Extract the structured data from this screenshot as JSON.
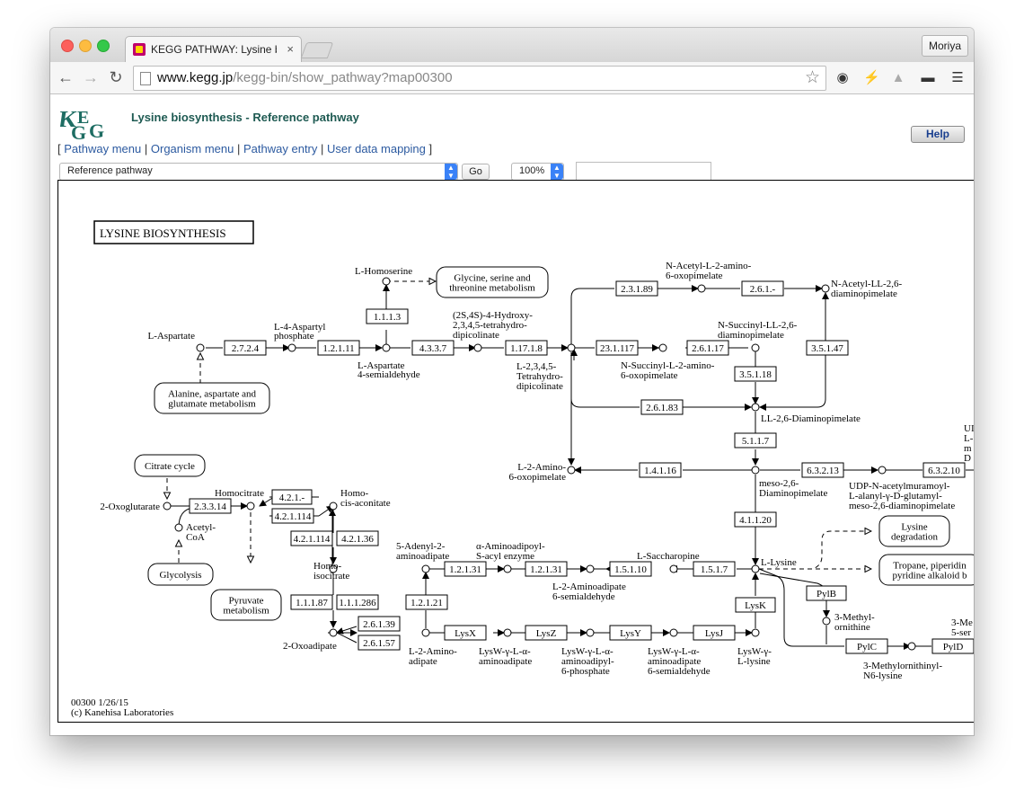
{
  "browser": {
    "tab_title": "KEGG PATHWAY: Lysine bio",
    "tab_close": "×",
    "profile": "Moriya",
    "url_host": "www.kegg.jp",
    "url_path": "/kegg-bin/show_pathway?map00300",
    "icons": [
      "back-arrow-icon",
      "forward-arrow-icon",
      "reload-icon",
      "page-icon",
      "bookmark-star-icon",
      "extension-icon",
      "lightning-icon",
      "drive-icon",
      "incognito-icon",
      "menu-icon"
    ]
  },
  "page": {
    "logo_alt": "KEGG",
    "title": "Lysine biosynthesis - Reference pathway",
    "help": "Help",
    "menu_open": "[",
    "menu_close": "]",
    "menu_sep": "|",
    "menu_links": [
      "Pathway menu",
      "Organism menu",
      "Pathway entry",
      "User data mapping"
    ],
    "select_value": "Reference pathway",
    "go": "Go",
    "zoom": "100%",
    "accent_color": "#1e5a52",
    "link_color": "#2c5aa0"
  },
  "map": {
    "title": "LYSINE  BIOSYNTHESIS",
    "footer_id": "00300 1/26/15",
    "footer_copy": "(c) Kanehisa Laboratories",
    "enzymes": [
      "2.7.2.4",
      "1.2.1.11",
      "4.3.3.7",
      "1.17.1.8",
      "1.1.1.3",
      "2.3.1.89",
      "2.6.1.-",
      "23.1.117",
      "2.6.1.17",
      "3.5.1.18",
      "3.5.1.47",
      "2.6.1.83",
      "5.1.1.7",
      "1.4.1.16",
      "6.3.2.13",
      "6.3.2.10",
      "4.1.1.20",
      "2.3.3.14",
      "4.2.1.-",
      "4.2.1.114",
      "4.2.1.114",
      "4.2.1.36",
      "1.1.1.87",
      "1.1.1.286",
      "2.6.1.39",
      "2.6.1.57",
      "1.2.1.21",
      "1.2.1.31",
      "1.2.1.31",
      "1.5.1.10",
      "1.5.1.7",
      "LysX",
      "LysZ",
      "LysY",
      "LysJ",
      "LysK",
      "PylB",
      "PylC",
      "PylD"
    ],
    "compounds": [
      "L-Homoserine",
      "L-Aspartate",
      "L-4-Aspartyl",
      "phosphate",
      "L-Aspartate",
      "4-semialdehyde",
      "(2S,4S)-4-Hydroxy-",
      "2,3,4,5-tetrahydro-",
      "dipicolinate",
      "L-2,3,4,5-",
      "Tetrahydro-",
      "dipicolinate",
      "N-Acetyl-L-2-amino-",
      "6-oxopimelate",
      "N-Acetyl-LL-2,6-",
      "diaminopimelate",
      "N-Succinyl-LL-2,6-",
      "diaminopimelate",
      "N-Succinyl-L-2-amino-",
      "6-oxopimelate",
      "LL-2,6-Diaminopimelate",
      "L-2-Amino-",
      "6-oxopimelate",
      "meso-2,6-",
      "Diaminopimelate",
      "UDP-N-acetylmuramoyl-",
      "L-alanyl-γ-D-glutamyl-",
      "meso-2,6-diaminopimelate",
      "2-Oxoglutarate",
      "Homocitrate",
      "Acetyl-",
      "CoA",
      "Homo-",
      "cis-aconitate",
      "Homo-",
      "isocitrate",
      "2-Oxoadipate",
      "5-Adenyl-2-",
      "aminoadipate",
      "α-Aminoadipoyl-",
      "S-acyl enzyme",
      "L-Saccharopine",
      "L-2-Aminoadipate",
      "6-semialdehyde",
      "L-Lysine",
      "L-2-Amino-",
      "adipate",
      "LysW-γ-L-α-",
      "aminoadipate",
      "LysW-γ-L-α-",
      "aminoadipyl-",
      "6-phosphate",
      "LysW-γ-L-α-",
      "aminoadipate",
      "6-semialdehyde",
      "LysW-γ-",
      "L-lysine",
      "3-Methyl-",
      "ornithine",
      "3-Methylornithinyl-",
      "N6-lysine",
      "3-Me",
      "5-ser",
      "UI",
      "L-",
      "m",
      "D"
    ],
    "map_links": [
      "Glycine, serine and",
      "threonine metabolism",
      "Alanine, aspartate and",
      "glutamate metabolism",
      "Citrate cycle",
      "Glycolysis",
      "Pyruvate",
      "metabolism",
      "Lysine",
      "degradation",
      "Tropane, piperidin",
      "pyridine alkaloid b"
    ]
  }
}
